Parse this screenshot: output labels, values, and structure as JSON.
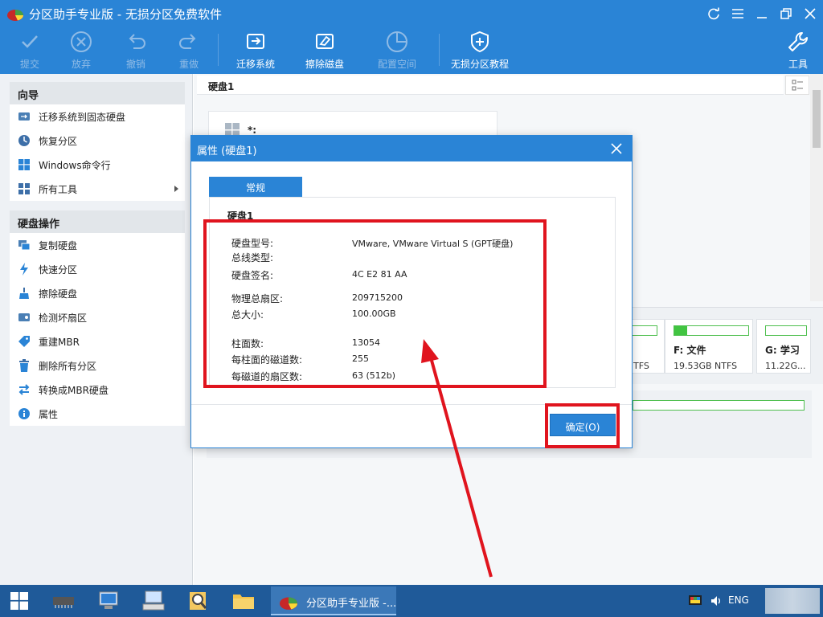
{
  "window": {
    "title": "分区助手专业版 - 无损分区免费软件"
  },
  "toolbar": {
    "commit": "提交",
    "discard": "放弃",
    "undo": "撤销",
    "redo": "重做",
    "migrate": "迁移系统",
    "wipe": "擦除磁盘",
    "allocate": "配置空间",
    "tutorial": "无损分区教程",
    "tools": "工具"
  },
  "sidebar": {
    "wizard_title": "向导",
    "wizard_items": [
      {
        "label": "迁移系统到固态硬盘"
      },
      {
        "label": "恢复分区"
      },
      {
        "label": "Windows命令行"
      },
      {
        "label": "所有工具"
      }
    ],
    "disk_ops_title": "硬盘操作",
    "disk_ops_items": [
      {
        "label": "复制硬盘"
      },
      {
        "label": "快速分区"
      },
      {
        "label": "擦除硬盘"
      },
      {
        "label": "检测坏扇区"
      },
      {
        "label": "重建MBR"
      },
      {
        "label": "删除所有分区"
      },
      {
        "label": "转换成MBR硬盘"
      },
      {
        "label": "属性"
      }
    ]
  },
  "main": {
    "disk_header": "硬盘1",
    "card_label": "*:",
    "partitions": [
      {
        "name": "",
        "info": "TFS",
        "fill": 0
      },
      {
        "name": "F: 文件",
        "info": "19.53GB NTFS",
        "fill": 0.17
      },
      {
        "name": "G: 学习",
        "info": "11.22G...",
        "fill": 0
      }
    ]
  },
  "dialog": {
    "title": "属性 (硬盘1)",
    "tab": "常规",
    "heading": "硬盘1",
    "fields": [
      {
        "label": "硬盘型号:",
        "value": "VMware, VMware Virtual S (GPT硬盘)"
      },
      {
        "label": "总线类型:",
        "value": ""
      },
      {
        "label": "硬盘签名:",
        "value": "4C E2 81 AA"
      },
      {
        "label": "物理总扇区:",
        "value": "209715200"
      },
      {
        "label": "总大小:",
        "value": "100.00GB"
      },
      {
        "label": "柱面数:",
        "value": "13054"
      },
      {
        "label": "每柱面的磁道数:",
        "value": "255"
      },
      {
        "label": "每磁道的扇区数:",
        "value": "63 (512b)"
      }
    ],
    "ok": "确定(O)"
  },
  "taskbar": {
    "active_app": "分区助手专业版 -...",
    "lang": "ENG"
  },
  "colors": {
    "accent": "#2a84d6",
    "annotation_red": "#e0141e",
    "partition_green": "#41c441"
  }
}
